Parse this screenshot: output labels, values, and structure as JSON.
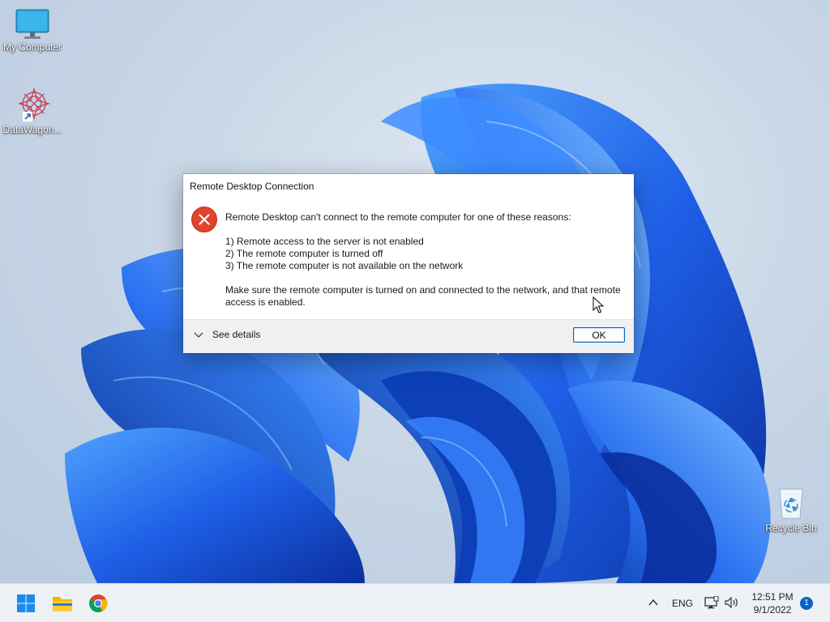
{
  "desktop": {
    "icons": [
      {
        "label": "My Computer",
        "icon": "monitor-icon"
      },
      {
        "label": "DataWagon...",
        "icon": "datawagon-logo-icon"
      },
      {
        "label": "Recycle Bin",
        "icon": "recycle-bin-icon"
      }
    ]
  },
  "dialog": {
    "title": "Remote Desktop Connection",
    "icon": "error-icon",
    "message": "Remote Desktop can't connect to the remote computer for one of these reasons:",
    "reasons": [
      "1) Remote access to the server is not enabled",
      "2) The remote computer is turned off",
      "3) The remote computer is not available on the network"
    ],
    "advice": "Make sure the remote computer is turned on and connected to the network, and that remote access is enabled.",
    "details_label": "See details",
    "ok_label": "OK"
  },
  "taskbar": {
    "apps": [
      "start-icon",
      "file-explorer-icon",
      "chrome-icon"
    ],
    "language": "ENG",
    "time": "12:51 PM",
    "date": "9/1/2022",
    "notification_count": "1"
  },
  "colors": {
    "accent": "#0067c0",
    "error": "#e0442a",
    "taskbar": "#eef2f7",
    "wallpaper_blue": "#1f5fe6"
  }
}
